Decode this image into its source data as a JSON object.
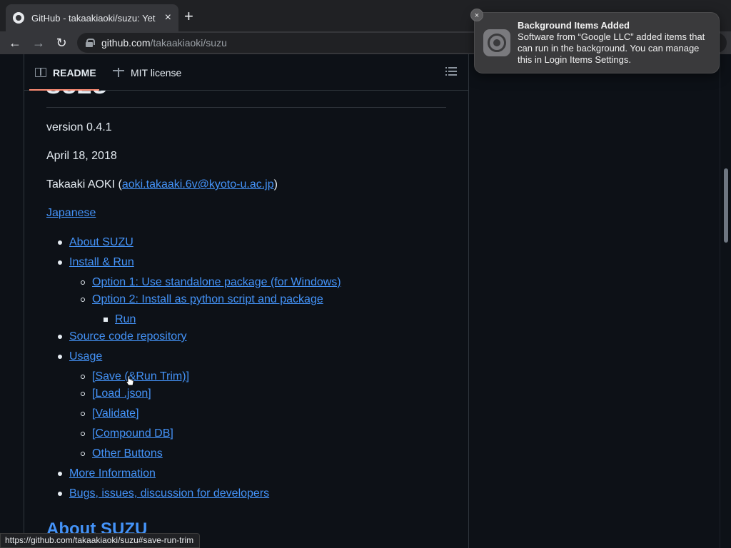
{
  "browser": {
    "tab_title": "GitHub - takaakiaoki/suzu: Yet",
    "tab_close": "×",
    "new_tab": "+",
    "url_host": "github.com",
    "url_path": "/takaakiaoki/suzu",
    "back": "←",
    "forward": "→",
    "reload": "↻"
  },
  "readme": {
    "tab_readme": "README",
    "tab_license": "MIT license",
    "heading_partial": "SUZU",
    "version": "version 0.4.1",
    "date": "April 18, 2018",
    "author_prefix": "Takaaki AOKI (",
    "author_email": "aoki.takaaki.6v@kyoto-u.ac.jp",
    "author_suffix": ")",
    "japanese_link": "Japanese",
    "toc": [
      {
        "label": "About SUZU",
        "level": 1
      },
      {
        "label": "Install & Run",
        "level": 1
      },
      {
        "label": "Option 1: Use standalone package (for Windows)",
        "level": 2
      },
      {
        "label": "Option 2: Install as python script and package",
        "level": 2
      },
      {
        "label": "Run",
        "level": 3
      },
      {
        "label": "Source code repository",
        "level": 1
      },
      {
        "label": "Usage",
        "level": 1
      },
      {
        "label": "[Save (&Run Trim)]",
        "level": 2
      },
      {
        "label": "[Load .json]",
        "level": 2
      },
      {
        "label": "[Validate]",
        "level": 2
      },
      {
        "label": "[Compound DB]",
        "level": 2
      },
      {
        "label": "Other Buttons",
        "level": 2
      },
      {
        "label": "More Information",
        "level": 1
      },
      {
        "label": "Bugs, issues, discussion for developers",
        "level": 1
      }
    ],
    "section_heading": "About SUZU"
  },
  "notification": {
    "title": "Background Items Added",
    "body": "Software from “Google LLC” added items that can run in the background. You can manage this in Login Items Settings.",
    "close": "×"
  },
  "status_bar": {
    "url": "https://github.com/takaakiaoki/suzu#save-run-trim"
  },
  "colors": {
    "link": "#4493f8",
    "background": "#0d1117",
    "active_tab_underline": "#fd8c73"
  }
}
